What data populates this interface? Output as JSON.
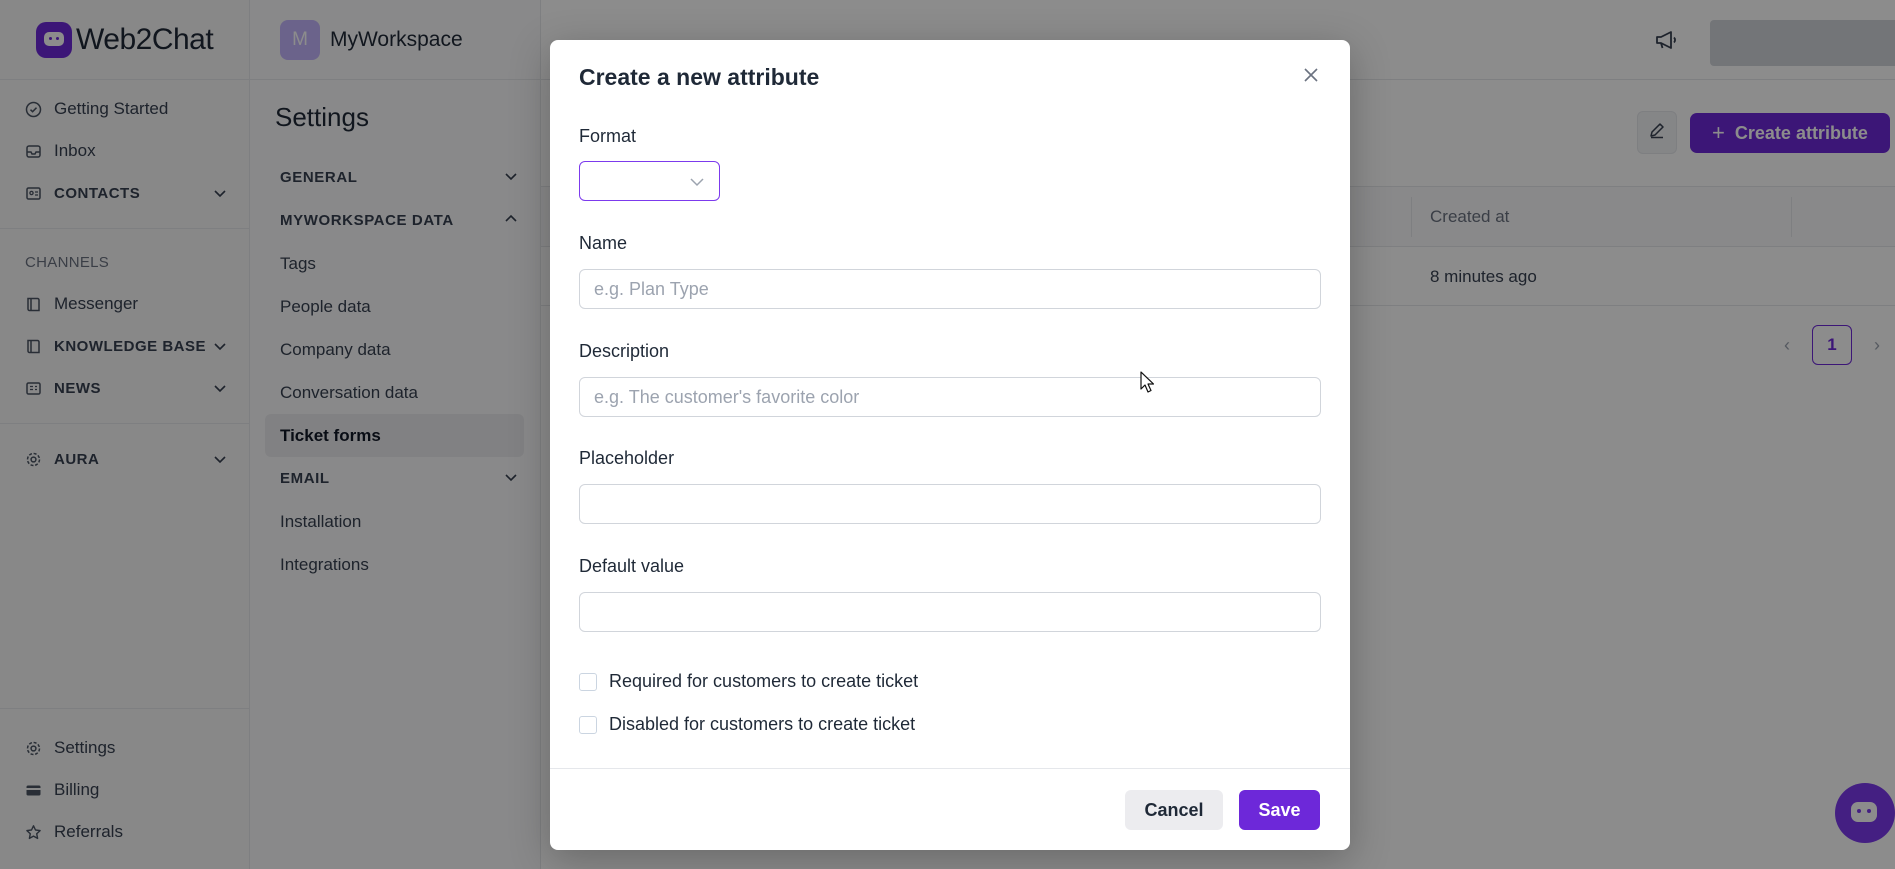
{
  "app": {
    "brand": "Web2Chat",
    "accent": "#6d28d9"
  },
  "sidebar": {
    "items_top": [
      {
        "label": "Getting Started",
        "icon": "check-circle-icon"
      },
      {
        "label": "Inbox",
        "icon": "inbox-icon"
      },
      {
        "label": "CONTACTS",
        "icon": "contacts-icon"
      }
    ],
    "channels_label": "CHANNELS",
    "items_channels": [
      {
        "label": "Messenger",
        "icon": "book-icon"
      },
      {
        "label": "KNOWLEDGE BASE",
        "icon": "book-icon"
      },
      {
        "label": "NEWS",
        "icon": "news-icon"
      }
    ],
    "aura": {
      "label": "AURA",
      "icon": "gear-icon"
    },
    "items_bottom": [
      {
        "label": "Settings",
        "icon": "gear-icon"
      },
      {
        "label": "Billing",
        "icon": "card-icon"
      },
      {
        "label": "Referrals",
        "icon": "star-icon"
      }
    ]
  },
  "subnav": {
    "workspace_initial": "M",
    "workspace_name": "MyWorkspace",
    "title": "Settings",
    "general_label": "GENERAL",
    "data_label": "MYWORKSPACE DATA",
    "data_items": [
      "Tags",
      "People data",
      "Company data",
      "Conversation data",
      "Ticket forms"
    ],
    "email_label": "EMAIL",
    "other_items": [
      "Installation",
      "Integrations"
    ]
  },
  "main": {
    "create_button": "Create attribute",
    "table": {
      "column_created": "Created at",
      "row_created": "8 minutes ago"
    },
    "pagination": {
      "current_page": "1"
    }
  },
  "modal": {
    "title": "Create a new attribute",
    "format_label": "Format",
    "format_value": "",
    "name_label": "Name",
    "name_placeholder": "e.g. Plan Type",
    "description_label": "Description",
    "description_placeholder": "e.g. The customer's favorite color",
    "placeholder_label": "Placeholder",
    "default_label": "Default value",
    "required_label": "Required for customers to create ticket",
    "disabled_label": "Disabled for customers to create ticket",
    "cancel_label": "Cancel",
    "save_label": "Save"
  }
}
